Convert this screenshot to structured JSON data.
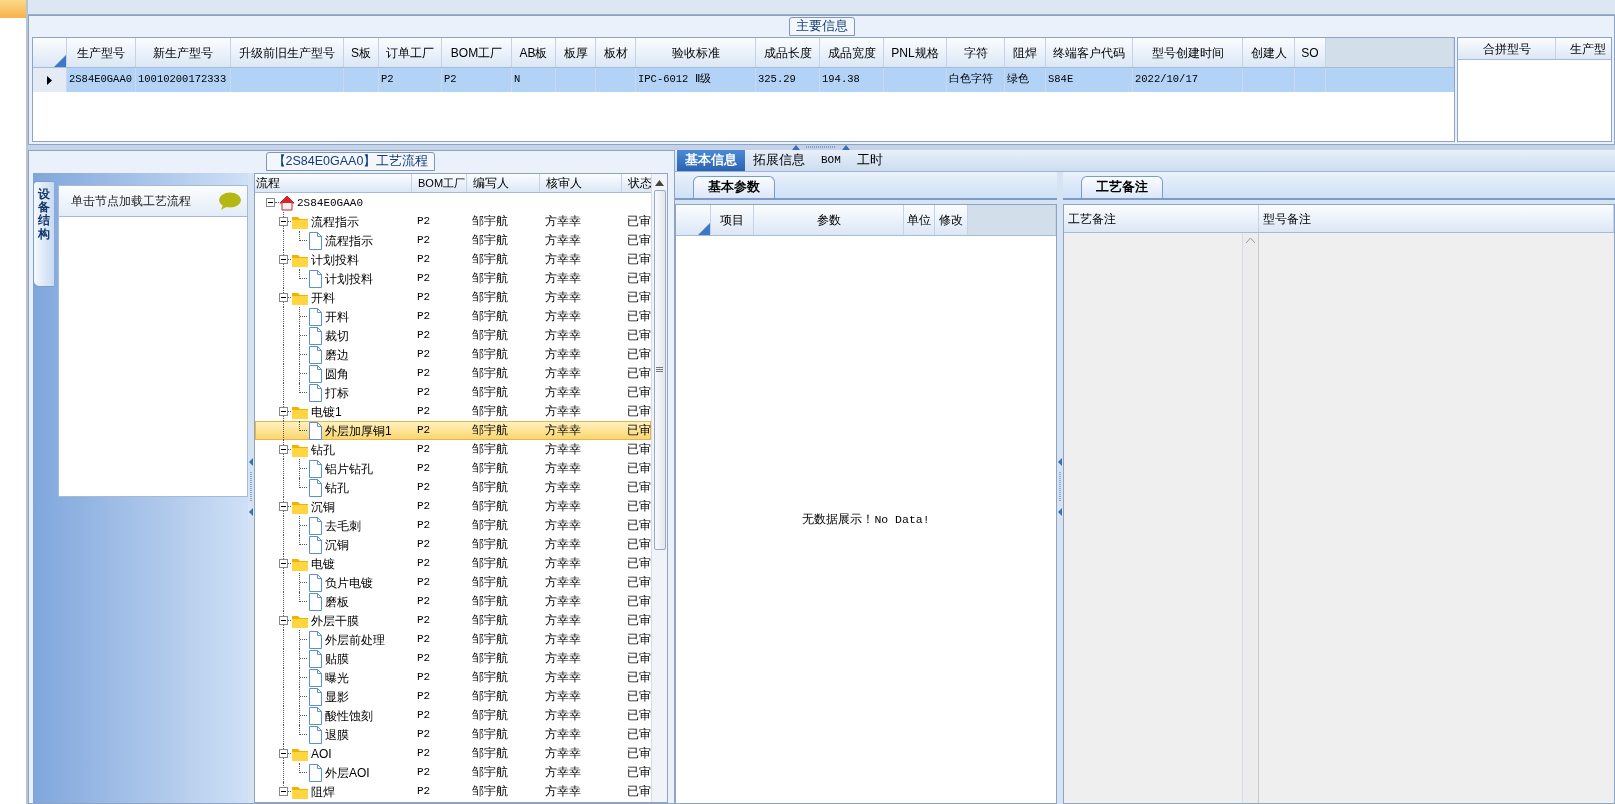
{
  "main_info": {
    "legend": "主要信息",
    "columns": [
      "生产型号",
      "新生产型号",
      "升级前旧生产型号",
      "S板",
      "订单工厂",
      "BOM工厂",
      "AB板",
      "板厚",
      "板材",
      "验收标准",
      "成品长度",
      "成品宽度",
      "PNL规格",
      "字符",
      "阻焊",
      "终端客户代码",
      "型号创建时间",
      "创建人",
      "SO"
    ],
    "rows": [
      {
        "selected": true,
        "cells": [
          "2S84E0GAA0",
          "10010200172333",
          null,
          null,
          "P2",
          "P2",
          "N",
          null,
          null,
          "IPC-6012 Ⅱ级",
          "325.29",
          "194.38",
          null,
          "白色字符",
          "绿色",
          "S84E",
          "2022/10/17",
          null,
          null
        ]
      }
    ]
  },
  "merge_grid": {
    "columns": [
      "合拼型号",
      "生产型"
    ]
  },
  "process": {
    "legend": "【2S84E0GAA0】工艺流程",
    "side_tab": "设备结构",
    "hint": "单击节点加载工艺流程",
    "columns": [
      "流程",
      "BOM工厂",
      "编写人",
      "核审人",
      "状态"
    ],
    "tree": [
      {
        "name": "2S84E0GAA0",
        "kind": "root",
        "expanded": true,
        "selected": false,
        "children": [
          {
            "name": "流程指示",
            "kind": "folder",
            "bom_factory": "P2",
            "writer": "邹宇航",
            "reviewer": "方幸幸",
            "status": "已审",
            "expanded": true,
            "selected": false,
            "children": [
              {
                "name": "流程指示",
                "kind": "step",
                "bom_factory": "P2",
                "writer": "邹宇航",
                "reviewer": "方幸幸",
                "status": "已审",
                "selected": false
              }
            ]
          },
          {
            "name": "计划投料",
            "kind": "folder",
            "bom_factory": "P2",
            "writer": "邹宇航",
            "reviewer": "方幸幸",
            "status": "已审",
            "expanded": true,
            "selected": false,
            "children": [
              {
                "name": "计划投料",
                "kind": "step",
                "bom_factory": "P2",
                "writer": "邹宇航",
                "reviewer": "方幸幸",
                "status": "已审",
                "selected": false
              }
            ]
          },
          {
            "name": "开料",
            "kind": "folder",
            "bom_factory": "P2",
            "writer": "邹宇航",
            "reviewer": "方幸幸",
            "status": "已审",
            "expanded": true,
            "selected": false,
            "children": [
              {
                "name": "开料",
                "kind": "step",
                "bom_factory": "P2",
                "writer": "邹宇航",
                "reviewer": "方幸幸",
                "status": "已审",
                "selected": false
              },
              {
                "name": "裁切",
                "kind": "step",
                "bom_factory": "P2",
                "writer": "邹宇航",
                "reviewer": "方幸幸",
                "status": "已审",
                "selected": false
              },
              {
                "name": "磨边",
                "kind": "step",
                "bom_factory": "P2",
                "writer": "邹宇航",
                "reviewer": "方幸幸",
                "status": "已审",
                "selected": false
              },
              {
                "name": "圆角",
                "kind": "step",
                "bom_factory": "P2",
                "writer": "邹宇航",
                "reviewer": "方幸幸",
                "status": "已审",
                "selected": false
              },
              {
                "name": "打标",
                "kind": "step",
                "bom_factory": "P2",
                "writer": "邹宇航",
                "reviewer": "方幸幸",
                "status": "已审",
                "selected": false
              }
            ]
          },
          {
            "name": "电镀1",
            "kind": "folder",
            "bom_factory": "P2",
            "writer": "邹宇航",
            "reviewer": "方幸幸",
            "status": "已审",
            "expanded": true,
            "selected": false,
            "children": [
              {
                "name": "外层加厚铜1",
                "kind": "step",
                "bom_factory": "P2",
                "writer": "邹宇航",
                "reviewer": "方幸幸",
                "status": "已审",
                "selected": true
              }
            ]
          },
          {
            "name": "钻孔",
            "kind": "folder",
            "bom_factory": "P2",
            "writer": "邹宇航",
            "reviewer": "方幸幸",
            "status": "已审",
            "expanded": true,
            "selected": false,
            "children": [
              {
                "name": "铝片钻孔",
                "kind": "step",
                "bom_factory": "P2",
                "writer": "邹宇航",
                "reviewer": "方幸幸",
                "status": "已审",
                "selected": false
              },
              {
                "name": "钻孔",
                "kind": "step",
                "bom_factory": "P2",
                "writer": "邹宇航",
                "reviewer": "方幸幸",
                "status": "已审",
                "selected": false
              }
            ]
          },
          {
            "name": "沉铜",
            "kind": "folder",
            "bom_factory": "P2",
            "writer": "邹宇航",
            "reviewer": "方幸幸",
            "status": "已审",
            "expanded": true,
            "selected": false,
            "children": [
              {
                "name": "去毛刺",
                "kind": "step",
                "bom_factory": "P2",
                "writer": "邹宇航",
                "reviewer": "方幸幸",
                "status": "已审",
                "selected": false
              },
              {
                "name": "沉铜",
                "kind": "step",
                "bom_factory": "P2",
                "writer": "邹宇航",
                "reviewer": "方幸幸",
                "status": "已审",
                "selected": false
              }
            ]
          },
          {
            "name": "电镀",
            "kind": "folder",
            "bom_factory": "P2",
            "writer": "邹宇航",
            "reviewer": "方幸幸",
            "status": "已审",
            "expanded": true,
            "selected": false,
            "children": [
              {
                "name": "负片电镀",
                "kind": "step",
                "bom_factory": "P2",
                "writer": "邹宇航",
                "reviewer": "方幸幸",
                "status": "已审",
                "selected": false
              },
              {
                "name": "磨板",
                "kind": "step",
                "bom_factory": "P2",
                "writer": "邹宇航",
                "reviewer": "方幸幸",
                "status": "已审",
                "selected": false
              }
            ]
          },
          {
            "name": "外层干膜",
            "kind": "folder",
            "bom_factory": "P2",
            "writer": "邹宇航",
            "reviewer": "方幸幸",
            "status": "已审",
            "expanded": true,
            "selected": false,
            "children": [
              {
                "name": "外层前处理",
                "kind": "step",
                "bom_factory": "P2",
                "writer": "邹宇航",
                "reviewer": "方幸幸",
                "status": "已审",
                "selected": false
              },
              {
                "name": "贴膜",
                "kind": "step",
                "bom_factory": "P2",
                "writer": "邹宇航",
                "reviewer": "方幸幸",
                "status": "已审",
                "selected": false
              },
              {
                "name": "曝光",
                "kind": "step",
                "bom_factory": "P2",
                "writer": "邹宇航",
                "reviewer": "方幸幸",
                "status": "已审",
                "selected": false
              },
              {
                "name": "显影",
                "kind": "step",
                "bom_factory": "P2",
                "writer": "邹宇航",
                "reviewer": "方幸幸",
                "status": "已审",
                "selected": false
              },
              {
                "name": "酸性蚀刻",
                "kind": "step",
                "bom_factory": "P2",
                "writer": "邹宇航",
                "reviewer": "方幸幸",
                "status": "已审",
                "selected": false
              },
              {
                "name": "退膜",
                "kind": "step",
                "bom_factory": "P2",
                "writer": "邹宇航",
                "reviewer": "方幸幸",
                "status": "已审",
                "selected": false
              }
            ]
          },
          {
            "name": "AOI",
            "kind": "folder",
            "bom_factory": "P2",
            "writer": "邹宇航",
            "reviewer": "方幸幸",
            "status": "已审",
            "expanded": true,
            "selected": false,
            "children": [
              {
                "name": "外层AOI",
                "kind": "step",
                "bom_factory": "P2",
                "writer": "邹宇航",
                "reviewer": "方幸幸",
                "status": "已审",
                "selected": false
              }
            ]
          },
          {
            "name": "阻焊",
            "kind": "folder",
            "bom_factory": "P2",
            "writer": "邹宇航",
            "reviewer": "方幸幸",
            "status": "已审",
            "expanded": true,
            "selected": false
          }
        ]
      }
    ]
  },
  "detail_tabs": [
    {
      "label": "基本信息",
      "selected": true
    },
    {
      "label": "拓展信息",
      "selected": false
    },
    {
      "label": "BOM",
      "selected": false
    },
    {
      "label": "工时",
      "selected": false
    }
  ],
  "params": {
    "tab": "基本参数",
    "columns": [
      "项目",
      "参数",
      "单位",
      "修改"
    ],
    "empty_text": "无数据展示！No Data!"
  },
  "remarks": {
    "tab": "工艺备注",
    "columns": [
      "工艺备注",
      "型号备注"
    ]
  }
}
